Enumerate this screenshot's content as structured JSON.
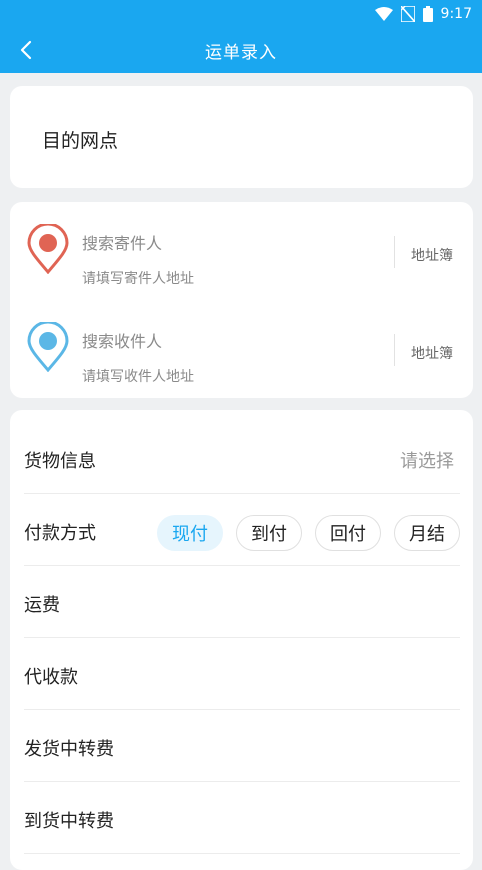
{
  "status_bar": {
    "time": "9:17"
  },
  "header": {
    "title": "运单录入"
  },
  "destination": {
    "label": "目的网点"
  },
  "sender": {
    "search_label": "搜索寄件人",
    "address_hint": "请填写寄件人地址",
    "book_label": "地址簿",
    "pin_color": "#e06454"
  },
  "receiver": {
    "search_label": "搜索收件人",
    "address_hint": "请填写收件人地址",
    "book_label": "地址簿",
    "pin_color": "#5bb7e6"
  },
  "goods": {
    "label": "货物信息",
    "placeholder": "请选择"
  },
  "payment": {
    "label": "付款方式",
    "options": [
      "现付",
      "到付",
      "回付",
      "月结"
    ],
    "selected": "现付"
  },
  "fields": {
    "freight": "运费",
    "cod": "代收款",
    "send_transfer_fee": "发货中转费",
    "arrive_transfer_fee": "到货中转费"
  },
  "colors": {
    "accent": "#1aa7f0",
    "background": "#eef0f2"
  }
}
